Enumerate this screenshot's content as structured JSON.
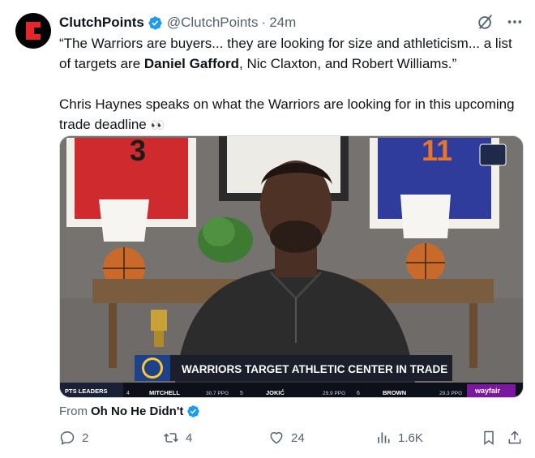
{
  "author": {
    "name": "ClutchPoints",
    "handle": "@ClutchPoints",
    "separator": "·",
    "time": "24m",
    "avatar_icon": "clutchpoints-logo-icon"
  },
  "tweet": {
    "quote_open": "“The Warriors are buyers... they are looking for size and athleticism... a list of targets are ",
    "quote_bold": "Daniel Gafford",
    "quote_close": ", Nic Claxton, and Robert Williams.”",
    "body": "Chris Haynes speaks on what the Warriors are looking for in this upcoming trade deadline",
    "emoji": "👀"
  },
  "media": {
    "jersey_left": "3",
    "jersey_right": "11",
    "lower_third": "WARRIORS TARGET ATHLETIC CENTER IN TRADE",
    "ticker_label": "PTS LEADERS",
    "ticker": [
      {
        "rank": "4",
        "name": "MITCHELL",
        "stat": "30.7 PPG"
      },
      {
        "rank": "5",
        "name": "JOKIĆ",
        "stat": "29.9 PPG"
      },
      {
        "rank": "6",
        "name": "BROWN",
        "stat": "29.3 PPG"
      }
    ],
    "sponsor": "wayfair"
  },
  "from": {
    "prefix": "From",
    "source": "Oh No He Didn't"
  },
  "actions": {
    "replies": "2",
    "reposts": "4",
    "likes": "24",
    "views": "1.6K"
  },
  "colors": {
    "verified": "#1d9bf0",
    "text_secondary": "#536471",
    "brand_red": "#e8262a",
    "lower_third_bg": "#1b1e2b"
  }
}
